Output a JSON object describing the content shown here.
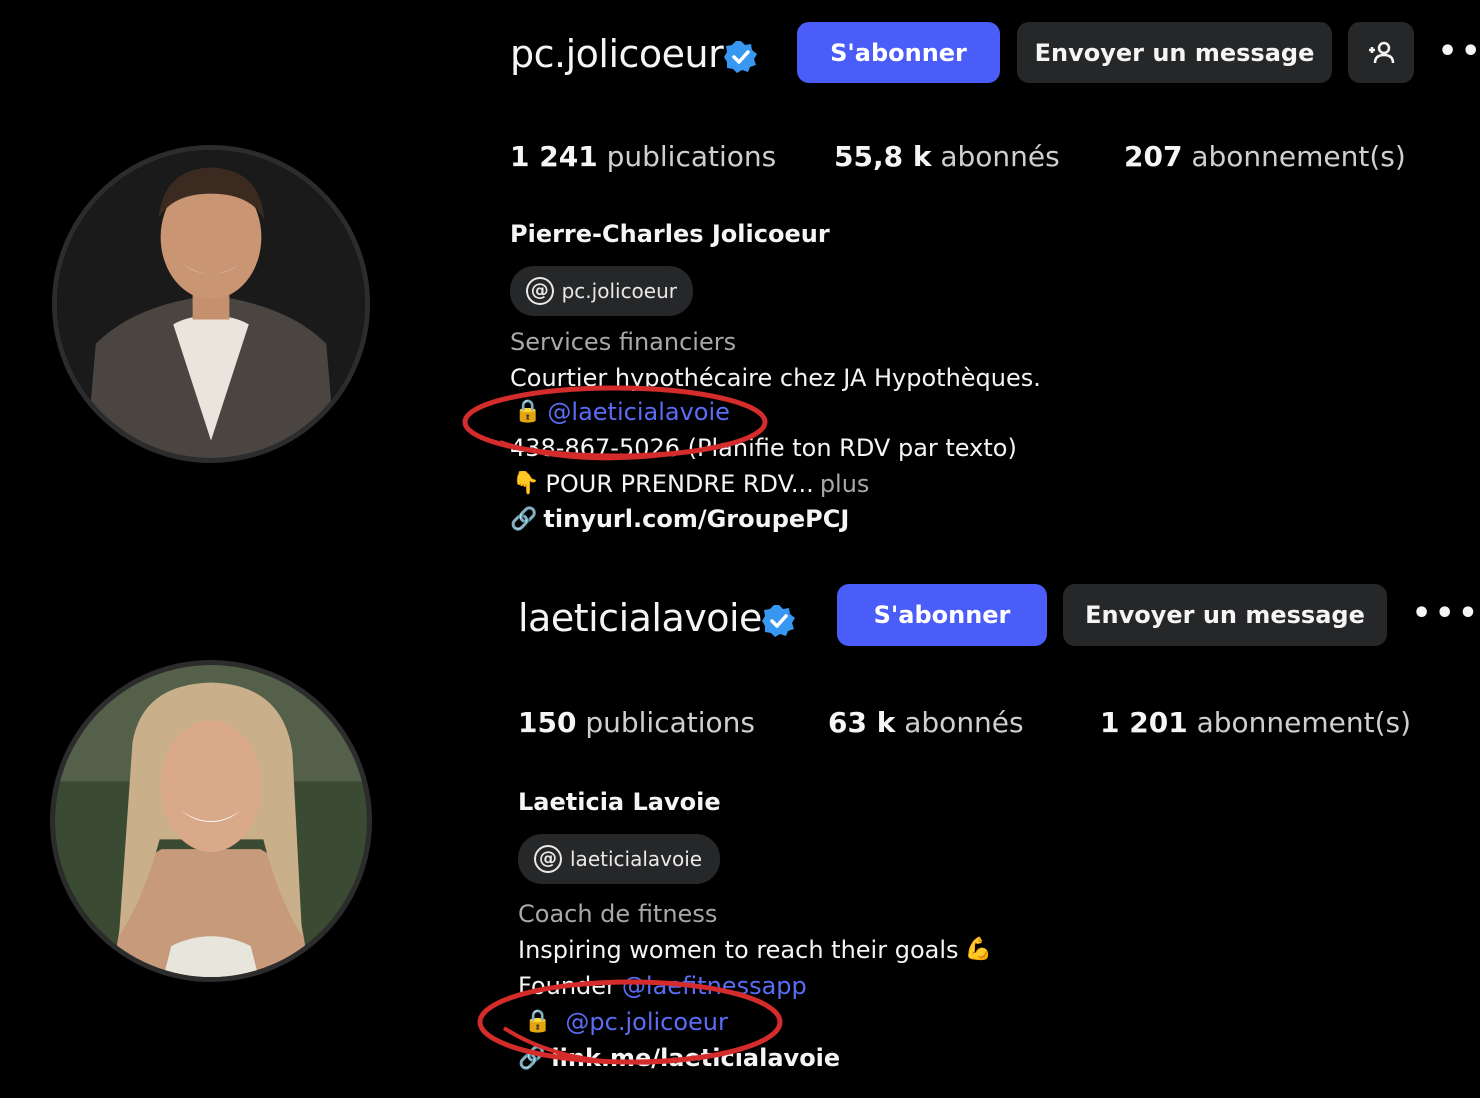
{
  "profiles": [
    {
      "username": "pc.jolicoeur",
      "follow_label": "S'abonner",
      "message_label": "Envoyer un message",
      "has_suggest_button": true,
      "more_label": "•••",
      "stats": {
        "posts_num": "1 241",
        "posts_lbl": "publications",
        "followers_num": "55,8 k",
        "followers_lbl": "abonnés",
        "following_num": "207",
        "following_lbl": "abonnement(s)"
      },
      "full_name": "Pierre-Charles Jolicoeur",
      "threads_handle": "pc.jolicoeur",
      "category": "Services financiers",
      "bio": {
        "line1": "Courtier hypothécaire chez JA Hypothèques.",
        "line2_mention": "@laeticialavoie",
        "line3": "438-867-5026 (Planifie ton RDV par texto)",
        "line4": "POUR PRENDRE RDV...",
        "line4_more": "plus",
        "link": "tinyurl.com/GroupePCJ"
      }
    },
    {
      "username": "laeticialavoie",
      "follow_label": "S'abonner",
      "message_label": "Envoyer un message",
      "more_label": "•••",
      "stats": {
        "posts_num": "150",
        "posts_lbl": "publications",
        "followers_num": "63 k",
        "followers_lbl": "abonnés",
        "following_num": "1 201",
        "following_lbl": "abonnement(s)"
      },
      "full_name": "Laeticia Lavoie",
      "threads_handle": "laeticialavoie",
      "category": "Coach de fitness",
      "bio": {
        "line1": "Inspiring women to reach their goals",
        "line2_prefix": "Founder",
        "line2_mention": "@laefitnessapp",
        "line3_mention": "@pc.jolicoeur",
        "link": "link.me/laeticialavoie"
      }
    }
  ],
  "colors": {
    "background": "#000000",
    "primary_button": "#4a5df9",
    "secondary_button": "#262729",
    "mention": "#5b6cf5",
    "verified": "#3897f0",
    "annotation": "#d42b2b"
  },
  "icons": {
    "verified": "verified-badge-icon",
    "lock": "lock-icon",
    "point_down": "point-down-icon",
    "muscle": "flexed-biceps-icon",
    "link": "link-icon",
    "threads": "threads-icon",
    "add_person": "add-person-icon"
  }
}
